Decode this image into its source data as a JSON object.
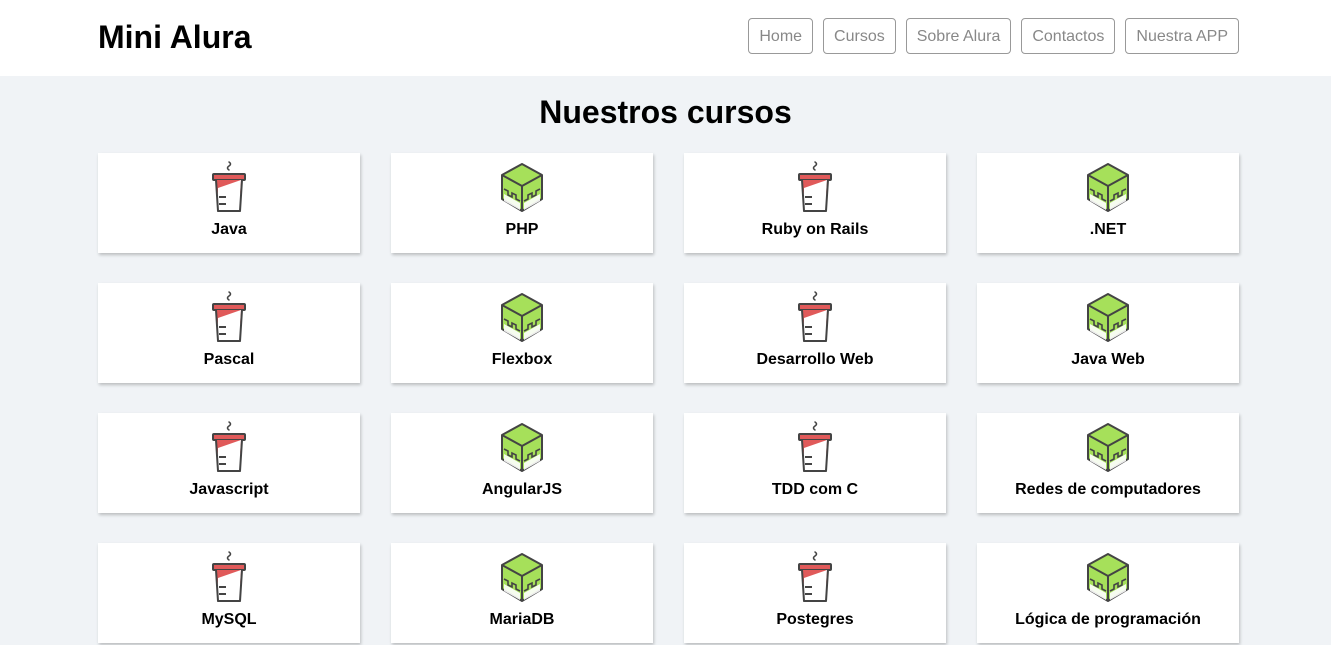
{
  "header": {
    "logo": "Mini Alura",
    "nav": [
      "Home",
      "Cursos",
      "Sobre Alura",
      "Contactos",
      "Nuestra APP"
    ]
  },
  "main": {
    "title": "Nuestros cursos",
    "courses": [
      {
        "name": "Java",
        "icon": "coffee-cup-icon"
      },
      {
        "name": "PHP",
        "icon": "cube-icon"
      },
      {
        "name": "Ruby on Rails",
        "icon": "coffee-cup-icon"
      },
      {
        "name": ".NET",
        "icon": "cube-icon"
      },
      {
        "name": "Pascal",
        "icon": "coffee-cup-icon"
      },
      {
        "name": "Flexbox",
        "icon": "cube-icon"
      },
      {
        "name": "Desarrollo Web",
        "icon": "coffee-cup-icon"
      },
      {
        "name": "Java Web",
        "icon": "cube-icon"
      },
      {
        "name": "Javascript",
        "icon": "coffee-cup-icon"
      },
      {
        "name": "AngularJS",
        "icon": "cube-icon"
      },
      {
        "name": "TDD com C",
        "icon": "coffee-cup-icon"
      },
      {
        "name": "Redes de computadores",
        "icon": "cube-icon"
      },
      {
        "name": "MySQL",
        "icon": "coffee-cup-icon"
      },
      {
        "name": "MariaDB",
        "icon": "cube-icon"
      },
      {
        "name": "Postegres",
        "icon": "coffee-cup-icon"
      },
      {
        "name": "Lógica de programación",
        "icon": "cube-icon"
      }
    ]
  },
  "colors": {
    "page_background": "#f0f3f6",
    "cup_red": "#e05a5a",
    "cube_green": "#a6e05a",
    "outline": "#444444"
  }
}
